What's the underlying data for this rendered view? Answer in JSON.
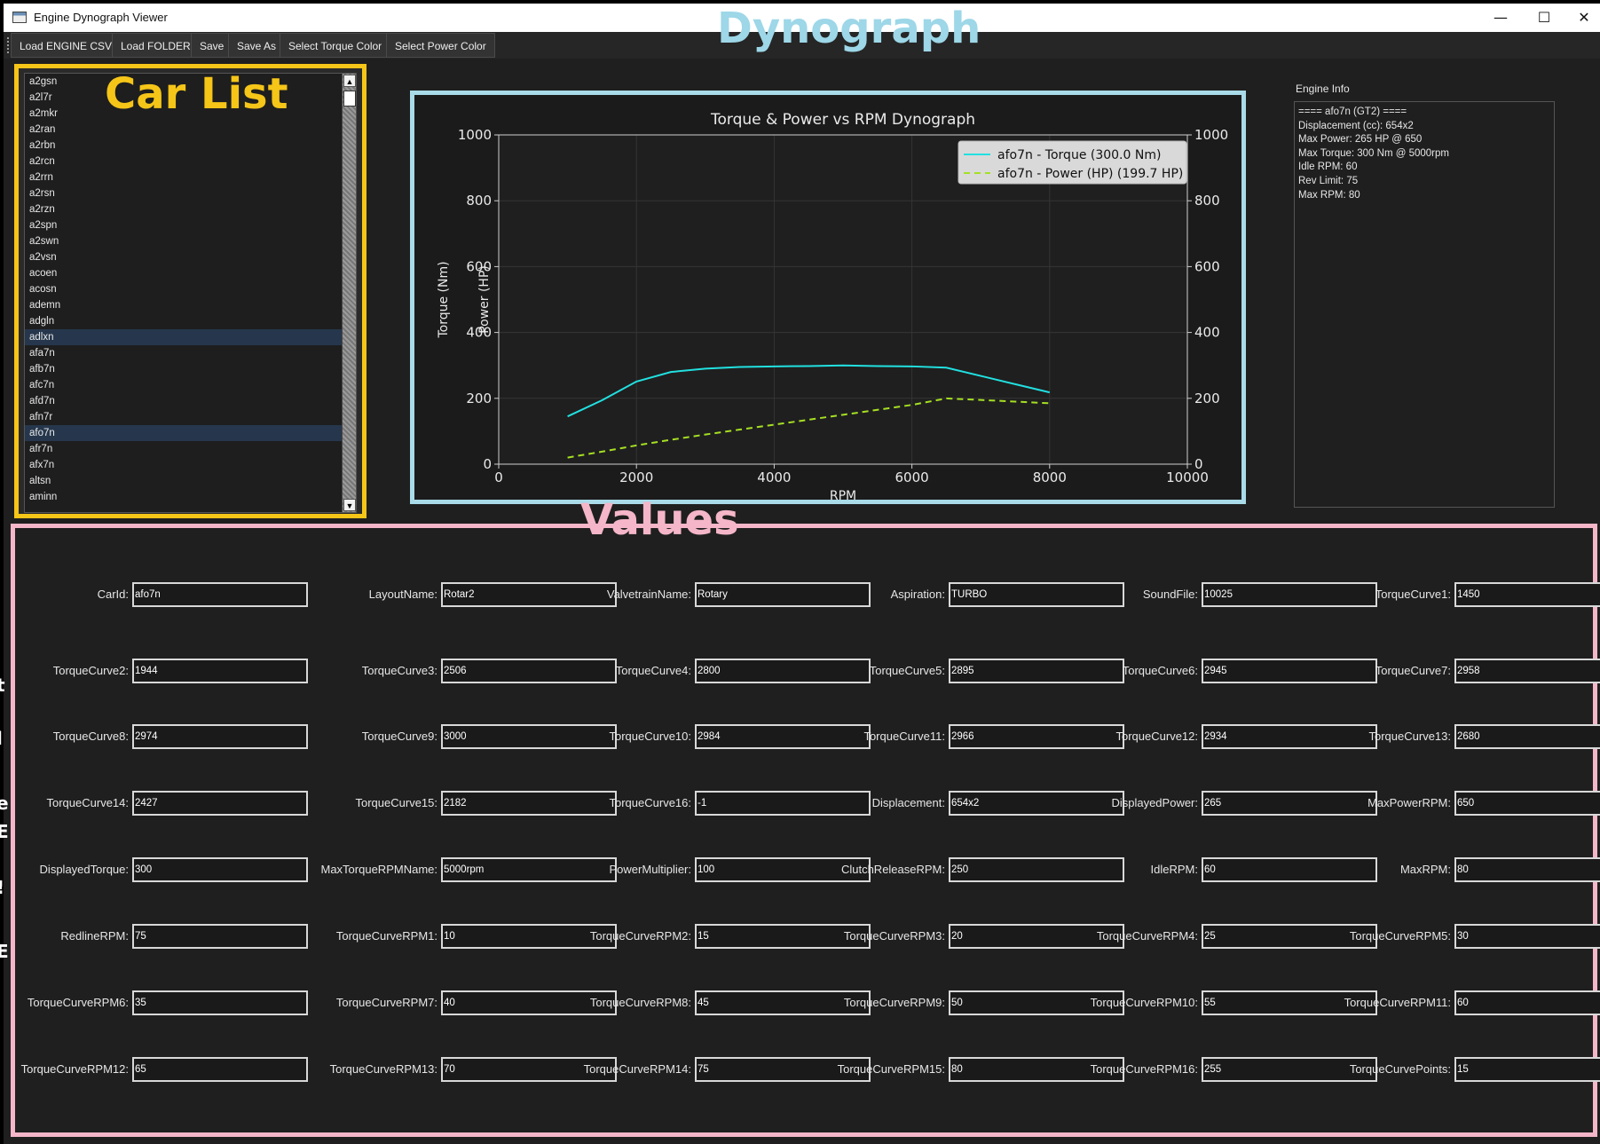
{
  "window": {
    "title": "Engine Dynograph Viewer",
    "minimize_glyph": "—",
    "maximize_glyph": "☐",
    "close_glyph": "✕"
  },
  "toolbar": [
    {
      "label": "Load ENGINE CSV"
    },
    {
      "label": "Load FOLDER"
    },
    {
      "label": "Save"
    },
    {
      "label": "Save As"
    },
    {
      "label": "Select Torque Color"
    },
    {
      "label": "Select Power Color"
    }
  ],
  "sections": {
    "car_list": "Car List",
    "dynograph": "Dynograph",
    "values": "Values"
  },
  "car_list": {
    "items": [
      "a2gsn",
      "a2l7r",
      "a2mkr",
      "a2ran",
      "a2rbn",
      "a2rcn",
      "a2rrn",
      "a2rsn",
      "a2rzn",
      "a2spn",
      "a2swn",
      "a2vsn",
      "acoen",
      "acosn",
      "ademn",
      "adgln",
      "adlxn",
      "afa7n",
      "afb7n",
      "afc7n",
      "afd7n",
      "afn7r",
      "afo7n",
      "afr7n",
      "afx7n",
      "altsn",
      "aminn"
    ],
    "highlighted": [
      "adlxn",
      "afo7n"
    ]
  },
  "engine_info": {
    "label": "Engine Info",
    "lines": [
      "==== afo7n (GT2) ====",
      "Displacement (cc): 654x2",
      "Max Power: 265 HP @ 650",
      "Max Torque: 300 Nm @ 5000rpm",
      "Idle RPM: 60",
      "Rev Limit: 75",
      "Max RPM: 80"
    ]
  },
  "chart_data": {
    "type": "line",
    "title": "Torque & Power vs RPM Dynograph",
    "xlabel": "RPM",
    "ylabel": "Torque (Nm)",
    "ylabel_right": "Power (HP)",
    "xlim": [
      0,
      10000
    ],
    "ylim": [
      0,
      1000
    ],
    "xticks": [
      0,
      2000,
      4000,
      6000,
      8000,
      10000
    ],
    "yticks": [
      0,
      200,
      400,
      600,
      800,
      1000
    ],
    "grid": true,
    "legend_position": "top-right",
    "series": [
      {
        "name": "afo7n - Torque (300.0 Nm)",
        "color": "#22e0e0",
        "dash": "solid",
        "x": [
          1000,
          1500,
          2000,
          2500,
          3000,
          3500,
          4000,
          4500,
          5000,
          5500,
          6000,
          6500,
          7000,
          7500,
          8000
        ],
        "y": [
          145,
          194,
          251,
          280,
          290,
          295,
          297,
          298,
          300,
          298,
          297,
          293,
          268,
          243,
          218
        ]
      },
      {
        "name": "afo7n - Power (HP) (199.7 HP)",
        "color": "#a6e022",
        "dash": "dashed",
        "x": [
          1000,
          1500,
          2000,
          2500,
          3000,
          3500,
          4000,
          4500,
          5000,
          5500,
          6000,
          6500,
          7000,
          7500,
          8000
        ],
        "y": [
          20,
          38,
          57,
          74,
          90,
          105,
          120,
          135,
          150,
          165,
          180,
          199.7,
          195,
          190,
          185
        ]
      }
    ]
  },
  "fields": [
    {
      "label": "CarId:",
      "value": "afo7n"
    },
    {
      "label": "LayoutName:",
      "value": "Rotar2"
    },
    {
      "label": "ValvetrainName:",
      "value": "Rotary"
    },
    {
      "label": "Aspiration:",
      "value": "TURBO"
    },
    {
      "label": "SoundFile:",
      "value": "10025"
    },
    {
      "label": "TorqueCurve1:",
      "value": "1450"
    },
    {
      "label": "TorqueCurve2:",
      "value": "1944"
    },
    {
      "label": "TorqueCurve3:",
      "value": "2506"
    },
    {
      "label": "TorqueCurve4:",
      "value": "2800"
    },
    {
      "label": "TorqueCurve5:",
      "value": "2895"
    },
    {
      "label": "TorqueCurve6:",
      "value": "2945"
    },
    {
      "label": "TorqueCurve7:",
      "value": "2958"
    },
    {
      "label": "TorqueCurve8:",
      "value": "2974"
    },
    {
      "label": "TorqueCurve9:",
      "value": "3000"
    },
    {
      "label": "TorqueCurve10:",
      "value": "2984"
    },
    {
      "label": "TorqueCurve11:",
      "value": "2966"
    },
    {
      "label": "TorqueCurve12:",
      "value": "2934"
    },
    {
      "label": "TorqueCurve13:",
      "value": "2680"
    },
    {
      "label": "TorqueCurve14:",
      "value": "2427"
    },
    {
      "label": "TorqueCurve15:",
      "value": "2182"
    },
    {
      "label": "TorqueCurve16:",
      "value": "-1"
    },
    {
      "label": "Displacement:",
      "value": "654x2"
    },
    {
      "label": "DisplayedPower:",
      "value": "265"
    },
    {
      "label": "MaxPowerRPM:",
      "value": "650"
    },
    {
      "label": "DisplayedTorque:",
      "value": "300"
    },
    {
      "label": "MaxTorqueRPMName:",
      "value": "5000rpm"
    },
    {
      "label": "PowerMultiplier:",
      "value": "100"
    },
    {
      "label": "ClutchReleaseRPM:",
      "value": "250"
    },
    {
      "label": "IdleRPM:",
      "value": "60"
    },
    {
      "label": "MaxRPM:",
      "value": "80"
    },
    {
      "label": "RedlineRPM:",
      "value": "75"
    },
    {
      "label": "TorqueCurveRPM1:",
      "value": "10"
    },
    {
      "label": "TorqueCurveRPM2:",
      "value": "15"
    },
    {
      "label": "TorqueCurveRPM3:",
      "value": "20"
    },
    {
      "label": "TorqueCurveRPM4:",
      "value": "25"
    },
    {
      "label": "TorqueCurveRPM5:",
      "value": "30"
    },
    {
      "label": "TorqueCurveRPM6:",
      "value": "35"
    },
    {
      "label": "TorqueCurveRPM7:",
      "value": "40"
    },
    {
      "label": "TorqueCurveRPM8:",
      "value": "45"
    },
    {
      "label": "TorqueCurveRPM9:",
      "value": "50"
    },
    {
      "label": "TorqueCurveRPM10:",
      "value": "55"
    },
    {
      "label": "TorqueCurveRPM11:",
      "value": "60"
    },
    {
      "label": "TorqueCurveRPM12:",
      "value": "65"
    },
    {
      "label": "TorqueCurveRPM13:",
      "value": "70"
    },
    {
      "label": "TorqueCurveRPM14:",
      "value": "75"
    },
    {
      "label": "TorqueCurveRPM15:",
      "value": "80"
    },
    {
      "label": "TorqueCurveRPM16:",
      "value": "255"
    },
    {
      "label": "TorqueCurvePoints:",
      "value": "15"
    }
  ],
  "edge_chars": [
    "t",
    "l",
    "e",
    "E",
    "!",
    "E"
  ]
}
